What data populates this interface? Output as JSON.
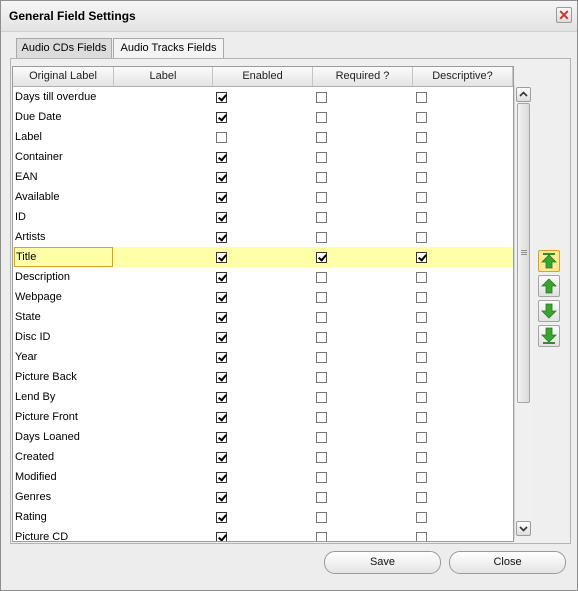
{
  "window": {
    "title": "General Field Settings"
  },
  "tabs": [
    {
      "label": "Audio CDs Fields",
      "active": true
    },
    {
      "label": "Audio Tracks Fields",
      "active": false
    }
  ],
  "columns": [
    "Original Label",
    "Label",
    "Enabled",
    "Required ?",
    "Descriptive?"
  ],
  "rows": [
    {
      "label": "Days till overdue",
      "enabled": true,
      "required": false,
      "descriptive": false
    },
    {
      "label": "Due Date",
      "enabled": true,
      "required": false,
      "descriptive": false
    },
    {
      "label": "Label",
      "enabled": false,
      "required": false,
      "descriptive": false
    },
    {
      "label": "Container",
      "enabled": true,
      "required": false,
      "descriptive": false
    },
    {
      "label": "EAN",
      "enabled": true,
      "required": false,
      "descriptive": false
    },
    {
      "label": "Available",
      "enabled": true,
      "required": false,
      "descriptive": false
    },
    {
      "label": "ID",
      "enabled": true,
      "required": false,
      "descriptive": false
    },
    {
      "label": "Artists",
      "enabled": true,
      "required": false,
      "descriptive": false
    },
    {
      "label": "Title",
      "enabled": true,
      "required": true,
      "descriptive": true,
      "selected": true
    },
    {
      "label": "Description",
      "enabled": true,
      "required": false,
      "descriptive": false
    },
    {
      "label": "Webpage",
      "enabled": true,
      "required": false,
      "descriptive": false
    },
    {
      "label": "State",
      "enabled": true,
      "required": false,
      "descriptive": false
    },
    {
      "label": "Disc ID",
      "enabled": true,
      "required": false,
      "descriptive": false
    },
    {
      "label": "Year",
      "enabled": true,
      "required": false,
      "descriptive": false
    },
    {
      "label": "Picture Back",
      "enabled": true,
      "required": false,
      "descriptive": false
    },
    {
      "label": "Lend By",
      "enabled": true,
      "required": false,
      "descriptive": false
    },
    {
      "label": "Picture Front",
      "enabled": true,
      "required": false,
      "descriptive": false
    },
    {
      "label": "Days Loaned",
      "enabled": true,
      "required": false,
      "descriptive": false
    },
    {
      "label": "Created",
      "enabled": true,
      "required": false,
      "descriptive": false
    },
    {
      "label": "Modified",
      "enabled": true,
      "required": false,
      "descriptive": false
    },
    {
      "label": "Genres",
      "enabled": true,
      "required": false,
      "descriptive": false
    },
    {
      "label": "Rating",
      "enabled": true,
      "required": false,
      "descriptive": false
    },
    {
      "label": "Picture CD",
      "enabled": true,
      "required": false,
      "descriptive": false
    }
  ],
  "move_buttons": [
    {
      "icon": "move-to-top-icon",
      "active": true
    },
    {
      "icon": "move-up-icon",
      "active": false
    },
    {
      "icon": "move-down-icon",
      "active": false
    },
    {
      "icon": "move-to-bottom-icon",
      "active": false
    }
  ],
  "buttons": {
    "save": "Save",
    "close": "Close"
  },
  "colors": {
    "selected_row": "#ffffa8",
    "arrow_green": "#3aa52e",
    "accent_border": "#e0a020"
  }
}
